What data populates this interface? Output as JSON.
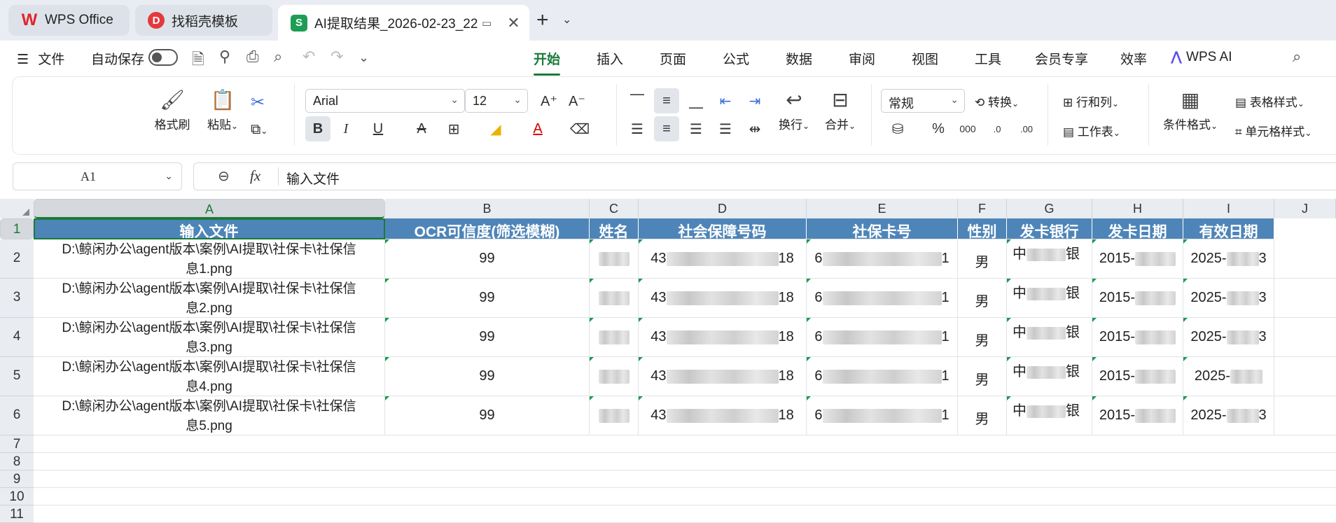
{
  "tabs": [
    {
      "label": "WPS Office"
    },
    {
      "label": "找稻壳模板"
    },
    {
      "label": "AI提取结果_2026-02-23_22"
    }
  ],
  "menu": {
    "file": "文件",
    "autosave": "自动保存",
    "tabs": [
      "开始",
      "插入",
      "页面",
      "公式",
      "数据",
      "审阅",
      "视图",
      "工具",
      "会员专享",
      "效率"
    ],
    "wps_ai": "WPS AI"
  },
  "ribbon": {
    "format_painter": "格式刷",
    "paste": "粘贴",
    "font": "Arial",
    "size": "12",
    "wrap": "换行",
    "merge": "合并",
    "numfmt": "常规",
    "convert": "转换",
    "rows_cols": "行和列",
    "worksheet": "工作表",
    "cond_format": "条件格式",
    "table_style": "表格样式",
    "cell_style": "单元格样式"
  },
  "formula": {
    "cell_ref": "A1",
    "value": "输入文件"
  },
  "columns": [
    "A",
    "B",
    "C",
    "D",
    "E",
    "F",
    "G",
    "H",
    "I",
    "J"
  ],
  "rows": [
    "1",
    "2",
    "3",
    "4",
    "5",
    "6",
    "7",
    "8",
    "9",
    "10",
    "11"
  ],
  "headers": [
    "输入文件",
    "OCR可信度(筛选模糊)",
    "姓名",
    "社会保障号码",
    "社保卡号",
    "性别",
    "发卡银行",
    "发卡日期",
    "有效日期"
  ],
  "data": [
    {
      "path1": "D:\\鲸闲办公\\agent版本\\案例\\AI提取\\社保卡\\社保信",
      "path2": "息1.png",
      "score": "99",
      "ssn_a": "43",
      "ssn_b": "18",
      "card_a": "6",
      "card_b": "1",
      "gender": "男",
      "bank_a": "中",
      "bank_b": "银",
      "issue": "2015-",
      "expire": "2025-",
      "exp_tail": "3"
    },
    {
      "path1": "D:\\鲸闲办公\\agent版本\\案例\\AI提取\\社保卡\\社保信",
      "path2": "息2.png",
      "score": "99",
      "ssn_a": "43",
      "ssn_b": "18",
      "card_a": "6",
      "card_b": "1",
      "gender": "男",
      "bank_a": "中",
      "bank_b": "银",
      "issue": "2015-",
      "expire": "2025-",
      "exp_tail": "3"
    },
    {
      "path1": "D:\\鲸闲办公\\agent版本\\案例\\AI提取\\社保卡\\社保信",
      "path2": "息3.png",
      "score": "99",
      "ssn_a": "43",
      "ssn_b": "18",
      "card_a": "6",
      "card_b": "1",
      "gender": "男",
      "bank_a": "中",
      "bank_b": "银",
      "issue": "2015-",
      "expire": "2025-",
      "exp_tail": "3"
    },
    {
      "path1": "D:\\鲸闲办公\\agent版本\\案例\\AI提取\\社保卡\\社保信",
      "path2": "息4.png",
      "score": "99",
      "ssn_a": "43",
      "ssn_b": "18",
      "card_a": "6",
      "card_b": "1",
      "gender": "男",
      "bank_a": "中",
      "bank_b": "银",
      "issue": "2015-",
      "expire": "2025-",
      "exp_tail": ""
    },
    {
      "path1": "D:\\鲸闲办公\\agent版本\\案例\\AI提取\\社保卡\\社保信",
      "path2": "息5.png",
      "score": "99",
      "ssn_a": "43",
      "ssn_b": "18",
      "card_a": "6",
      "card_b": "1",
      "gender": "男",
      "bank_a": "中",
      "bank_b": "银",
      "issue": "2015-",
      "expire": "2025-",
      "exp_tail": "3"
    }
  ],
  "colors": {
    "accent": "#1b7a3a",
    "header_bg": "#4e85b8"
  }
}
